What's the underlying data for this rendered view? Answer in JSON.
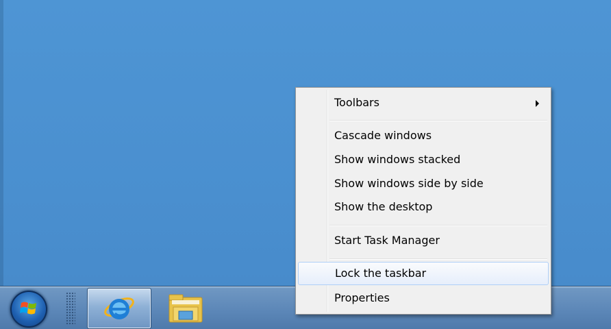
{
  "desktop": {
    "background_color": "#4a8fcf"
  },
  "taskbar": {
    "start_button": {
      "icon": "windows-logo-icon"
    },
    "pinned": [
      {
        "name": "Internet Explorer",
        "icon": "internet-explorer-icon",
        "active": true
      },
      {
        "name": "Windows Explorer",
        "icon": "folder-icon",
        "active": false
      }
    ]
  },
  "context_menu": {
    "items": [
      {
        "label": "Toolbars",
        "has_submenu": true
      },
      {
        "label": "Cascade windows"
      },
      {
        "label": "Show windows stacked"
      },
      {
        "label": "Show windows side by side"
      },
      {
        "label": "Show the desktop"
      },
      {
        "label": "Start Task Manager"
      },
      {
        "label": "Lock the taskbar",
        "highlighted": true
      },
      {
        "label": "Properties"
      }
    ]
  }
}
